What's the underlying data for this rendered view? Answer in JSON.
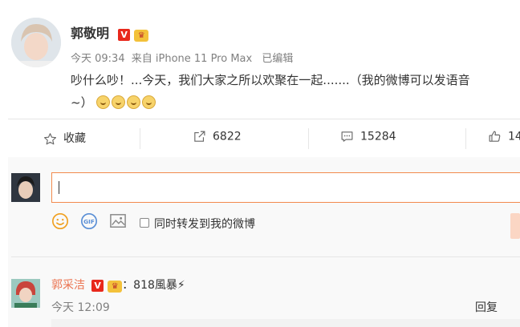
{
  "post": {
    "author": "郭敬明",
    "badges": {
      "verified": "V"
    },
    "meta": {
      "time": "今天 09:34",
      "source": "来自 iPhone 11 Pro Max",
      "edited": "已编辑"
    },
    "content_line1": "吵什么吵！...今天，我们大家之所以欢聚在一起.......（我的微博可以发语音",
    "content_line2": "~）",
    "emoji_count": 4,
    "emoji_name": "doge-emoji"
  },
  "actions": {
    "favorite": {
      "label": "收藏",
      "icon": "star-icon"
    },
    "repost": {
      "count": "6822",
      "icon": "share-icon"
    },
    "comment": {
      "count": "15284",
      "icon": "comment-icon"
    },
    "like": {
      "count": "14",
      "icon": "thumbs-up-icon"
    }
  },
  "composer": {
    "input_value": "",
    "tools": [
      "smile-icon",
      "gif-icon",
      "image-icon"
    ],
    "gif_label": "GIF",
    "repost_checkbox_label": "同时转发到我的微博",
    "checked": false
  },
  "comments": [
    {
      "author": "郭采洁",
      "text": "：818風暴⚡",
      "time": "今天 12:09",
      "reply_label": "回复"
    }
  ],
  "colors": {
    "accent": "#eb7350",
    "input_border": "#f28a4d",
    "send_button": "#fbd6c4",
    "divider": "#e6e6e6"
  }
}
